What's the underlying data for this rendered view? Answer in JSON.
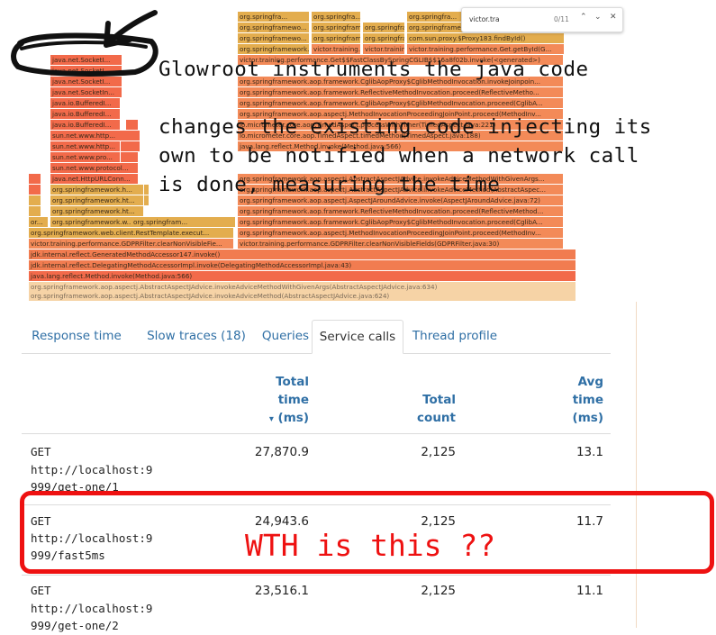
{
  "flame": {
    "frames": [
      {
        "t": "org.springfra...",
        "c": "y"
      },
      {
        "t": "org.springfra...",
        "c": "y"
      },
      {
        "t": "org.springfra...",
        "c": "y"
      },
      {
        "t": "org.springframewo...",
        "c": "y"
      },
      {
        "t": "org.springframewo...",
        "c": "y"
      },
      {
        "t": "org.springframework...",
        "c": "y"
      },
      {
        "t": "org.springframework...",
        "c": "y"
      },
      {
        "t": "org.springframewo...",
        "c": "y"
      },
      {
        "t": "org.springframewo...",
        "c": "y"
      },
      {
        "t": "org.springframework...",
        "c": "y"
      },
      {
        "t": "com.sun.proxy.$Proxy183.findById()",
        "c": "y"
      },
      {
        "t": "org.springframework...",
        "c": "y"
      },
      {
        "t": "victor.training...",
        "c": "o"
      },
      {
        "t": "victor.training.performa...",
        "c": "o"
      },
      {
        "t": "victor.training.performance.Get.getById(G...",
        "c": "o"
      },
      {
        "t": "victor.training.performance.Get$$FastClassBySpringCGLIB$$16a8f02b.invoke(<generated>)",
        "c": "o"
      },
      {
        "t": "java.net.SocketI...",
        "c": "r"
      },
      {
        "t": "java.net.SocketI...",
        "c": "r"
      },
      {
        "t": "java.net.SocketI...",
        "c": "r"
      },
      {
        "t": "java.net.SocketIn...",
        "c": "r"
      },
      {
        "t": "java.io.BufferedI...",
        "c": "r"
      },
      {
        "t": "java.io.BufferedI...",
        "c": "r"
      },
      {
        "t": "java.io.BufferedI...",
        "c": "r"
      },
      {
        "t": "sun.net.www.http...",
        "c": "r"
      },
      {
        "t": "sun.net.www.http...",
        "c": "r"
      },
      {
        "t": "sun.net.www.pro...",
        "c": "r"
      },
      {
        "t": "sun.net.www.protocol...",
        "c": "r"
      },
      {
        "t": "java.net.HttpURLConn...",
        "c": "r"
      },
      {
        "t": "org.springframework.aop.framework.CglibAopProxy$CglibMethodInvocation.invokeJoinpoin...",
        "c": "o"
      },
      {
        "t": "org.springframework.aop.framework.ReflectiveMethodInvocation.proceed(ReflectiveMetho...",
        "c": "o"
      },
      {
        "t": "org.springframework.aop.framework.CglibAopProxy$CglibMethodInvocation.proceed(CglibA...",
        "c": "o"
      },
      {
        "t": "org.springframework.aop.aspectj.MethodInvocationProceedingJoinPoint.proceed(MethodInv...",
        "c": "o"
      },
      {
        "t": "io.micrometer.core.aop.TimedAspect.processWithTimer(TimedAspect.java:221)",
        "c": "o"
      },
      {
        "t": "io.micrometer.core.aop.TimedAspect.timedMethod(TimedAspect.java:188)",
        "c": "o"
      },
      {
        "t": "java.lang.reflect.Method.invoke(Method.java:566)",
        "c": "o"
      },
      {
        "t": "org.springframework.h...",
        "c": "y"
      },
      {
        "t": "org.springframework.ht...",
        "c": "y"
      },
      {
        "t": "org.springframework.ht...",
        "c": "y"
      },
      {
        "t": "org.springframework.w...",
        "c": "y"
      },
      {
        "t": "or...",
        "c": "y"
      },
      {
        "t": "org.springfram...",
        "c": "y"
      },
      {
        "t": "org.springframework.aop.aspectj.AbstractAspectJAdvice.invokeAdviceMethodWithGivenArgs...",
        "c": "o"
      },
      {
        "t": "org.springframework.aop.aspectj.AbstractAspectJAdvice.invokeAdviceMethod(AbstractAspec...",
        "c": "o"
      },
      {
        "t": "org.springframework.aop.aspectj.AspectJAroundAdvice.invoke(AspectJAroundAdvice.java:72)",
        "c": "o"
      },
      {
        "t": "org.springframework.aop.framework.ReflectiveMethodInvocation.proceed(ReflectiveMethod...",
        "c": "o"
      },
      {
        "t": "org.springframework.aop.framework.CglibAopProxy$CglibMethodInvocation.proceed(CglibA...",
        "c": "o"
      },
      {
        "t": "org.springframework.aop.aspectj.MethodInvocationProceedingJoinPoint.proceed(MethodInv...",
        "c": "o"
      },
      {
        "t": "org.springframework.web.client.RestTemplate.execut...",
        "c": "y"
      },
      {
        "t": "org.springframework.web.client.RestTemplate.getFor...",
        "c": "y"
      },
      {
        "t": "victor.training.performance.GDPRFilter.clearNonVisibleFie...",
        "c": "o"
      },
      {
        "t": "victor.training.performance.GDPRFilter.clearNonVisibleFields(GDPRFilter.java:30)",
        "c": "o"
      },
      {
        "t": "jdk.internal.reflect.GeneratedMethodAccessor147.invoke()",
        "c": "s"
      },
      {
        "t": "jdk.internal.reflect.DelegatingMethodAccessorImpl.invoke(DelegatingMethodAccessorImpl.java:43)",
        "c": "s"
      },
      {
        "t": "java.lang.reflect.Method.invoke(Method.java:566)",
        "c": "r"
      },
      {
        "t": "org.springframework.aop.aspectj.AbstractAspectJAdvice.invokeAdviceMethodWithGivenArgs(AbstractAspectJAdvice.java:634)",
        "c": "l"
      },
      {
        "t": "org.springframework.aop.aspectj.AbstractAspectJAdvice.invokeAdviceMethod(AbstractAspectJAdvice.java:624)",
        "c": "l"
      }
    ]
  },
  "find_bar": {
    "query": "victor.tra",
    "count": "0/11",
    "up_icon": "chevron-up",
    "down_icon": "chevron-down",
    "close_icon": "close"
  },
  "annotation": {
    "line1": "Glowroot instruments the java code",
    "line2": "changes the existing code injecting its",
    "line3": "own to be notified when a network call",
    "line4": "is done, measuring the time",
    "wth": "WTH is this ??"
  },
  "tabs": [
    {
      "label": "Response time",
      "active": false
    },
    {
      "label": "Slow traces (18)",
      "active": false
    },
    {
      "label": "Queries",
      "active": false
    },
    {
      "label": "Service calls",
      "active": true
    },
    {
      "label": "Thread profile",
      "active": false
    }
  ],
  "table": {
    "headers": {
      "total_time": [
        "Total",
        "time",
        "(ms)"
      ],
      "sort_indicator": "▾",
      "total_count": [
        "Total",
        "count"
      ],
      "avg_time": [
        "Avg",
        "time",
        "(ms)"
      ]
    },
    "rows": [
      {
        "method": "GET",
        "url1": "http://localhost:9",
        "url2": "999/get-one/1",
        "total_time": "27,870.9",
        "total_count": "2,125",
        "avg_time": "13.1"
      },
      {
        "method": "GET",
        "url1": "http://localhost:9",
        "url2": "999/fast5ms",
        "total_time": "24,943.6",
        "total_count": "2,125",
        "avg_time": "11.7"
      },
      {
        "method": "GET",
        "url1": "http://localhost:9",
        "url2": "999/get-one/2",
        "total_time": "23,516.1",
        "total_count": "2,125",
        "avg_time": "11.1"
      }
    ]
  },
  "colors": {
    "link": "#2f6fa5",
    "highlight": "#ee1111",
    "flame_yellow": "#e3ad4e",
    "flame_orange": "#f38a58",
    "flame_red": "#f26a4a"
  }
}
